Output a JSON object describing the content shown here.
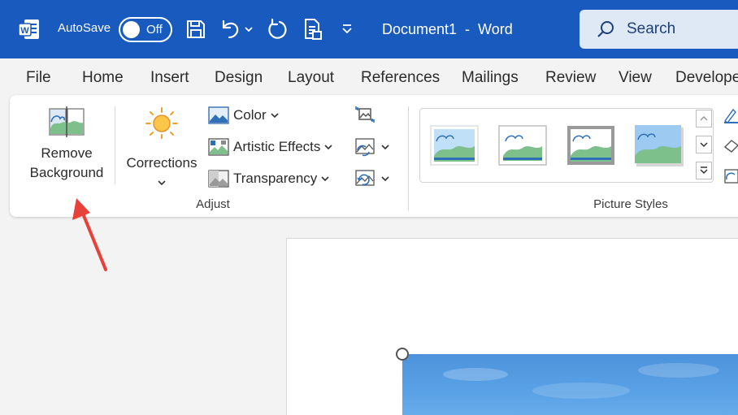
{
  "titlebar": {
    "app_icon": "word-logo-icon",
    "autosave_label": "AutoSave",
    "autosave_state": "Off",
    "document_title": "Document1  -  Word",
    "search_placeholder": "Search",
    "colors": {
      "titlebar_bg": "#185abd",
      "search_bg": "#dfe9f6"
    }
  },
  "menu": {
    "tabs": [
      "File",
      "Home",
      "Insert",
      "Design",
      "Layout",
      "References",
      "Mailings",
      "Review",
      "View",
      "Developer"
    ]
  },
  "ribbon": {
    "adjust": {
      "remove_background_line1": "Remove",
      "remove_background_line2": "Background",
      "corrections_label": "Corrections",
      "color_label": "Color",
      "artistic_effects_label": "Artistic Effects",
      "transparency_label": "Transparency",
      "group_label": "Adjust"
    },
    "picture_styles": {
      "group_label": "Picture Styles"
    }
  },
  "annotation": {
    "arrow_color": "#e8413a"
  }
}
